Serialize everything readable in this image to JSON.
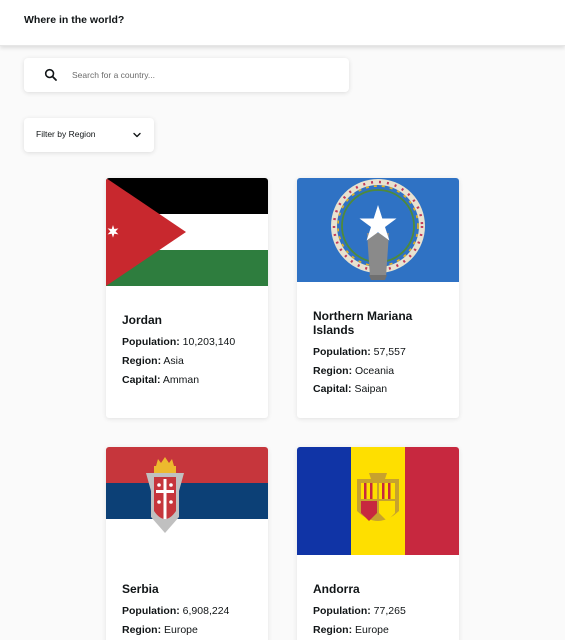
{
  "header": {
    "title": "Where in the world?"
  },
  "search": {
    "placeholder": "Search for a country..."
  },
  "filter": {
    "label": "Filter by Region"
  },
  "labels": {
    "population": "Population:",
    "region": "Region:",
    "capital": "Capital:"
  },
  "countries": [
    {
      "name": "Jordan",
      "population": "10,203,140",
      "region": "Asia",
      "capital": "Amman"
    },
    {
      "name": "Northern Mariana Islands",
      "population": "57,557",
      "region": "Oceania",
      "capital": "Saipan"
    },
    {
      "name": "Serbia",
      "population": "6,908,224",
      "region": "Europe"
    },
    {
      "name": "Andorra",
      "population": "77,265",
      "region": "Europe"
    }
  ],
  "colors": {
    "background": "#fafafa",
    "text": "#111517",
    "jordan_black": "#000000",
    "jordan_white": "#ffffff",
    "jordan_green": "#2e7d3e",
    "jordan_red": "#c8282e",
    "nmi_blue": "#2f72c4",
    "serbia_red": "#c6363c",
    "serbia_blue": "#0c4076",
    "andorra_blue": "#1034a6",
    "andorra_yellow": "#fedf00",
    "andorra_red": "#c7283f"
  }
}
